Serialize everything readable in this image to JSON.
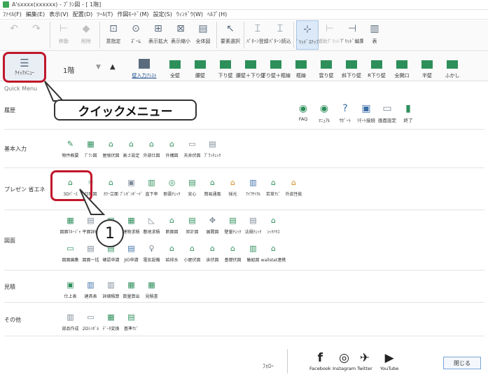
{
  "window": {
    "title": "A'sxxxx(xxxxxx) - ﾌﾟﾗﾝ図 - [ 1階]"
  },
  "menubar": [
    "ﾌｧｲﾙ(F)",
    "編集(E)",
    "表示(V)",
    "配置(D)",
    "ﾂｰﾙ(T)",
    "作図ﾓｰﾄﾞ(M)",
    "設定(S)",
    "ｳｨﾝﾄﾞｳ(W)",
    "ﾍﾙﾌﾟ(H)"
  ],
  "toolbar1": [
    {
      "label": "",
      "icon": "undo-icon",
      "glyph": "↶",
      "disabled": true
    },
    {
      "label": "",
      "icon": "redo-icon",
      "glyph": "↷",
      "disabled": true
    },
    {
      "label": "移動",
      "icon": "move-icon",
      "glyph": "⊢",
      "disabled": true
    },
    {
      "label": "削除",
      "icon": "delete-icon",
      "glyph": "◆",
      "disabled": true
    },
    {
      "label": "意指定",
      "icon": "zoom-area-icon",
      "glyph": "⊡",
      "disabled": false
    },
    {
      "label": "ｽﾞｰﾑ",
      "icon": "zoom-icon",
      "glyph": "⊙",
      "disabled": false
    },
    {
      "label": "表示拡大",
      "icon": "zoom-in-icon",
      "glyph": "⊞",
      "disabled": false
    },
    {
      "label": "表示縮小",
      "icon": "zoom-out-icon",
      "glyph": "⊠",
      "disabled": false
    },
    {
      "label": "全体図",
      "icon": "fit-all-icon",
      "glyph": "▤",
      "disabled": false
    },
    {
      "label": "要素選択",
      "icon": "select-icon",
      "glyph": "↖",
      "disabled": false
    },
    {
      "label": "ﾊﾟﾀｰﾝ登録",
      "icon": "pattern-save-icon",
      "glyph": "⌶",
      "disabled": false
    },
    {
      "label": "ﾊﾟﾀｰﾝ読込",
      "icon": "pattern-load-icon",
      "glyph": "⌶",
      "disabled": false
    },
    {
      "label": "ｸﾞﾘｯﾄﾞｽﾅｯﾌﾟ",
      "icon": "grid-snap-icon",
      "glyph": "⊹",
      "disabled": false,
      "highlight": true
    },
    {
      "label": "補助ｸﾞﾘｯﾄﾞ",
      "icon": "sub-grid-icon",
      "glyph": "⊢",
      "disabled": true
    },
    {
      "label": "ｸﾞﾘｯﾄﾞ編集",
      "icon": "grid-edit-icon",
      "glyph": "⊣",
      "disabled": false
    },
    {
      "label": "表",
      "icon": "table-icon",
      "glyph": "▥",
      "disabled": false
    }
  ],
  "toolbar2": {
    "quick_menu_label": "ｸｲｯｸﾒﾆｭｰ",
    "floor": "1階",
    "walls": [
      "壁入力ｱｼｽﾄ",
      "全壁",
      "腰壁",
      "下り壁",
      "腰壁＋下り壁",
      "下り壁＋框線",
      "框線",
      "雲り壁",
      "斜下り壁",
      "R下り壁",
      "全開口",
      "半壁",
      "ふかし"
    ]
  },
  "quick_menu": {
    "title": "Quick Menu",
    "callout": "クイックメニュー",
    "callout_number": "1",
    "sections": [
      {
        "label": "履歴",
        "items": []
      },
      {
        "label": "基本入力",
        "items": [
          {
            "label": "物件概要",
            "icon": "property-icon",
            "glyph": "✎",
            "tone": "g"
          },
          {
            "label": "ﾌﾟﾗﾝ図",
            "icon": "plan-icon",
            "glyph": "▦",
            "tone": "g"
          },
          {
            "label": "屋根伏図",
            "icon": "roof-icon",
            "glyph": "⌂",
            "tone": "g"
          },
          {
            "label": "高さ設定",
            "icon": "height-icon",
            "glyph": "⌂",
            "tone": "g"
          },
          {
            "label": "外部仕図",
            "icon": "exterior-icon",
            "glyph": "⌂",
            "tone": "g"
          },
          {
            "label": "外構図",
            "icon": "landscape-icon",
            "glyph": "⌂",
            "tone": "g"
          },
          {
            "label": "天井伏図",
            "icon": "ceiling-icon",
            "glyph": "▭",
            "tone": "gray"
          },
          {
            "label": "ﾌﾟﾗﾝﾁｪｯｸ",
            "icon": "plan-check-icon",
            "glyph": "▤",
            "tone": "gray"
          }
        ]
      },
      {
        "label": "プレゼン 省エネ",
        "items": [
          {
            "label": "3Dﾊﾟｰｽ",
            "icon": "3d-perspective-icon",
            "glyph": "⌂",
            "tone": "g"
          },
          {
            "label": "日陰図",
            "icon": "shadow-icon",
            "glyph": "☼",
            "tone": "g"
          },
          {
            "label": "ｶﾗｰ立面",
            "icon": "color-elevation-icon",
            "glyph": "⌂",
            "tone": "g"
          },
          {
            "label": "ﾌﾟﾚｾﾞﾝﾎﾞｰﾄﾞ",
            "icon": "presentation-board-icon",
            "glyph": "▣",
            "tone": "gray"
          },
          {
            "label": "直下率",
            "icon": "direct-ratio-icon",
            "glyph": "▥",
            "tone": "g"
          },
          {
            "label": "耐震ﾁｪｯｸ",
            "icon": "quake-check-icon",
            "glyph": "◎",
            "tone": "g"
          },
          {
            "label": "安心",
            "icon": "safety-icon",
            "glyph": "▤",
            "tone": "g"
          },
          {
            "label": "簡易通風",
            "icon": "ventilation-icon",
            "glyph": "⌂",
            "tone": "g"
          },
          {
            "label": "採光",
            "icon": "daylight-icon",
            "glyph": "⌂",
            "tone": "o"
          },
          {
            "label": "ﾗｲﾌｻｲｸﾙ",
            "icon": "lifecycle-icon",
            "glyph": "▥",
            "tone": "b"
          },
          {
            "label": "若草ﾅﾋﾞ",
            "icon": "wakakusa-icon",
            "glyph": "⌂",
            "tone": "g"
          },
          {
            "label": "外皮性能",
            "icon": "envelope-icon",
            "glyph": "⌂",
            "tone": "o"
          }
        ]
      },
      {
        "label": "図面",
        "items": [
          {
            "label": "図面ﾏﾈｰｼﾞｬ",
            "icon": "drawing-manager-icon",
            "glyph": "▦",
            "tone": "g"
          },
          {
            "label": "平面詳細",
            "icon": "plan-detail-icon",
            "glyph": "▤",
            "tone": "gray"
          },
          {
            "label": "",
            "icon": "plan-drawing-icon",
            "glyph": "▤",
            "tone": "g"
          },
          {
            "label": "建物求積",
            "icon": "building-area-icon",
            "glyph": "▦",
            "tone": "g"
          },
          {
            "label": "敷地求積",
            "icon": "site-area-icon",
            "glyph": "◺",
            "tone": "gray"
          },
          {
            "label": "断面図",
            "icon": "section-icon",
            "glyph": "⌂",
            "tone": "g"
          },
          {
            "label": "矩計図",
            "icon": "detail-section-icon",
            "glyph": "▤",
            "tone": "g"
          },
          {
            "label": "展開図",
            "icon": "development-icon",
            "glyph": "✥",
            "tone": "gray"
          },
          {
            "label": "壁量ﾁｪｯｸ",
            "icon": "wall-check-icon",
            "glyph": "▤",
            "tone": "g"
          },
          {
            "label": "法規ﾁｪｯｸ",
            "icon": "law-check-icon",
            "glyph": "▤",
            "tone": "gray"
          },
          {
            "label": "ｼｯｸﾊｳｽ",
            "icon": "sick-house-icon",
            "glyph": "⌂",
            "tone": "g"
          },
          {
            "label": "図面編集",
            "icon": "drawing-edit-icon",
            "glyph": "▭",
            "tone": "g"
          },
          {
            "label": "図面一括",
            "icon": "drawing-batch-icon",
            "glyph": "▤",
            "tone": "gray"
          },
          {
            "label": "確認申請",
            "icon": "application-icon",
            "glyph": "▤",
            "tone": "g"
          },
          {
            "label": "JIO申請",
            "icon": "jio-icon",
            "glyph": "▤",
            "tone": "b"
          },
          {
            "label": "電気設備",
            "icon": "electrical-icon",
            "glyph": "♀",
            "tone": "gray"
          },
          {
            "label": "給排水",
            "icon": "plumbing-icon",
            "glyph": "⌂",
            "tone": "g"
          },
          {
            "label": "小屋伏図",
            "icon": "attic-icon",
            "glyph": "⌂",
            "tone": "g"
          },
          {
            "label": "床伏図",
            "icon": "floor-frame-icon",
            "glyph": "⌂",
            "tone": "g"
          },
          {
            "label": "基礎伏図",
            "icon": "foundation-icon",
            "glyph": "⌂",
            "tone": "g"
          },
          {
            "label": "軸組図",
            "icon": "framing-icon",
            "glyph": "▥",
            "tone": "g"
          },
          {
            "label": "wallstat連携",
            "icon": "wallstat-icon",
            "glyph": "⌂",
            "tone": "g"
          }
        ]
      },
      {
        "label": "見積",
        "items": [
          {
            "label": "仕上表",
            "icon": "finish-table-icon",
            "glyph": "▣",
            "tone": "g"
          },
          {
            "label": "建具表",
            "icon": "fittings-icon",
            "glyph": "▥",
            "tone": "b"
          },
          {
            "label": "詳細積算",
            "icon": "detail-estimate-icon",
            "glyph": "▥",
            "tone": "gray"
          },
          {
            "label": "数量算出",
            "icon": "quantity-icon",
            "glyph": "▦",
            "tone": "g"
          },
          {
            "label": "見積書",
            "icon": "quote-icon",
            "glyph": "▦",
            "tone": "g"
          }
        ]
      },
      {
        "label": "その他",
        "items": [
          {
            "label": "部品作成",
            "icon": "parts-icon",
            "glyph": "▥",
            "tone": "gray"
          },
          {
            "label": "2Dｼﾝﾎﾞﾙ",
            "icon": "2d-symbol-icon",
            "glyph": "▭",
            "tone": "gray"
          },
          {
            "label": "ﾃﾞｰﾀ変換",
            "icon": "data-convert-icon",
            "glyph": "▦",
            "tone": "g"
          },
          {
            "label": "基準ﾅﾋﾞ",
            "icon": "standard-navi-icon",
            "glyph": "▤",
            "tone": "g"
          }
        ]
      }
    ],
    "top_right": [
      {
        "label": "FAQ",
        "icon": "faq-icon",
        "glyph": "◉",
        "tone": "g"
      },
      {
        "label": "ﾏﾆｭｱﾙ",
        "icon": "manual-icon",
        "glyph": "◉",
        "tone": "g"
      },
      {
        "label": "ｻﾎﾟｰﾄ",
        "icon": "support-icon",
        "glyph": "?",
        "tone": "b"
      },
      {
        "label": "ﾘﾓｰﾄ接続",
        "icon": "remote-icon",
        "glyph": "▣",
        "tone": "b"
      },
      {
        "label": "画面設定",
        "icon": "screen-settings-icon",
        "glyph": "▭",
        "tone": "gray"
      },
      {
        "label": "終了",
        "icon": "exit-icon",
        "glyph": "▮",
        "tone": "g"
      }
    ]
  },
  "footer": {
    "follow": "ﾌｫﾛｰ",
    "social": [
      {
        "label": "Facebook",
        "icon": "facebook-icon",
        "glyph": "f"
      },
      {
        "label": "Instagram",
        "icon": "instagram-icon",
        "glyph": "◎"
      },
      {
        "label": "Twitter",
        "icon": "twitter-icon",
        "glyph": "✈"
      },
      {
        "label": "YouTube",
        "icon": "youtube-icon",
        "glyph": "▶"
      }
    ],
    "close": "閉じる"
  },
  "colors": {
    "accent_red": "#c0172b",
    "wall_green": "#2d8f5a",
    "link_blue": "#1b4c8c"
  }
}
